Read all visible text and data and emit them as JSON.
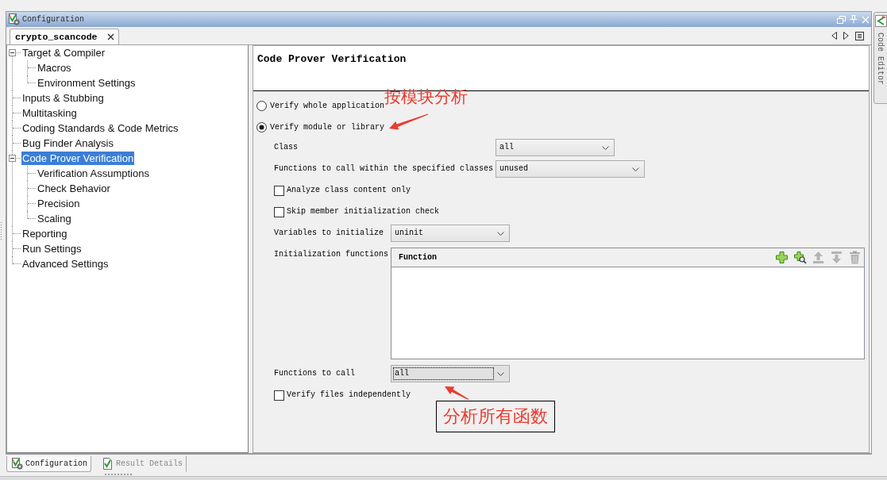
{
  "window": {
    "title": "Configuration"
  },
  "editor_tabs": [
    {
      "label": "crypto_scancode",
      "selected": true
    }
  ],
  "tree": {
    "items": [
      {
        "label": "Target & Compiler",
        "selected": false,
        "expanded": true,
        "children": [
          {
            "label": "Macros",
            "selected": false
          },
          {
            "label": "Environment Settings",
            "selected": false
          }
        ]
      },
      {
        "label": "Inputs & Stubbing",
        "selected": false
      },
      {
        "label": "Multitasking",
        "selected": false
      },
      {
        "label": "Coding Standards & Code Metrics",
        "selected": false
      },
      {
        "label": "Bug Finder Analysis",
        "selected": false
      },
      {
        "label": "Code Prover Verification",
        "selected": true,
        "expanded": true,
        "children": [
          {
            "label": "Verification Assumptions",
            "selected": false
          },
          {
            "label": "Check Behavior",
            "selected": false
          },
          {
            "label": "Precision",
            "selected": false
          },
          {
            "label": "Scaling",
            "selected": false
          }
        ]
      },
      {
        "label": "Reporting",
        "selected": false
      },
      {
        "label": "Run Settings",
        "selected": false
      },
      {
        "label": "Advanced Settings",
        "selected": false
      }
    ]
  },
  "page": {
    "heading": "Code Prover Verification",
    "modes": [
      {
        "label": "Verify whole application",
        "selected": false
      },
      {
        "label": "Verify module or library",
        "selected": true,
        "note": {
          "text": "按模块分析",
          "framed": false
        }
      }
    ],
    "options": [
      {
        "kind": "dropdown",
        "label": "Class",
        "value": "all",
        "focused": false
      },
      {
        "kind": "dropdown",
        "label": "Functions to call within the specified classes",
        "value": "unused",
        "focused": false
      },
      {
        "kind": "checkbox",
        "label": "Analyze class content only",
        "checked": false
      },
      {
        "kind": "checkbox",
        "label": "Skip member initialization check",
        "checked": false
      },
      {
        "kind": "dropdown",
        "label": "Variables to initialize",
        "value": "uninit",
        "focused": false
      },
      {
        "kind": "table",
        "label": "Initialization functions",
        "columns": [
          "Function"
        ]
      },
      {
        "kind": "dropdown",
        "label": "Functions to call",
        "value": "all",
        "focused": true,
        "note": {
          "text": "分析所有函数",
          "framed": true
        }
      },
      {
        "kind": "checkbox",
        "label": "Verify files independently",
        "checked": false
      }
    ]
  },
  "bottom_tabs": [
    {
      "label": "Configuration",
      "selected": true
    },
    {
      "label": "Result Details",
      "selected": false
    }
  ],
  "side_tabs": [
    {
      "label": "Code Editor"
    }
  ]
}
